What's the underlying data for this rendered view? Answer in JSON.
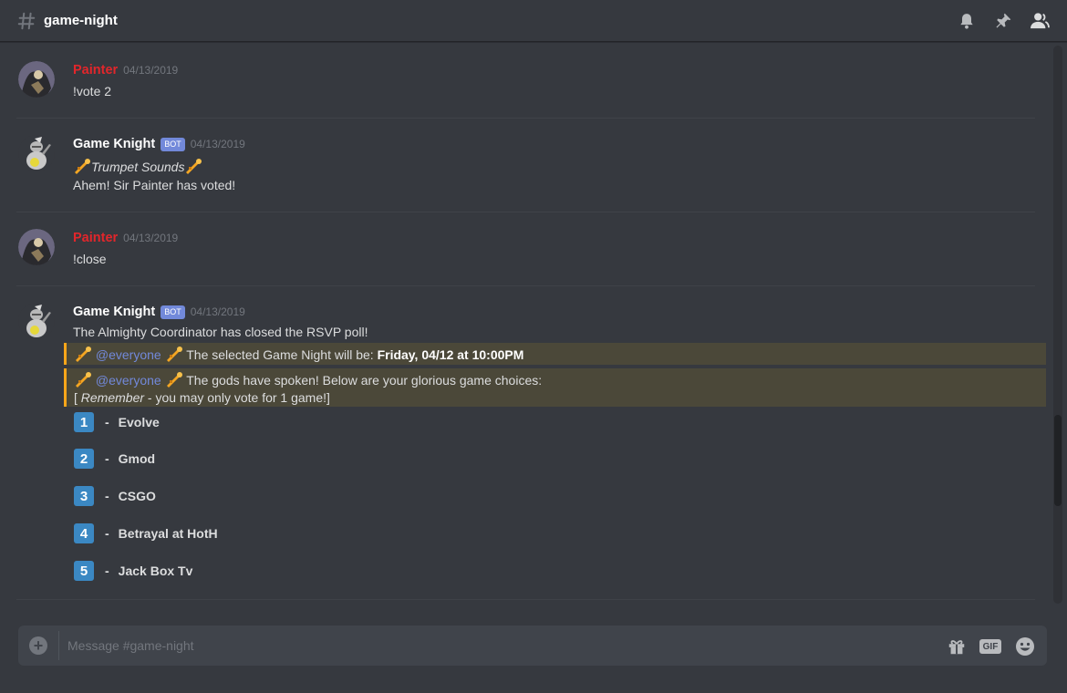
{
  "header": {
    "channel": "game-night"
  },
  "messages": [
    {
      "author": "Painter",
      "timestamp": "04/13/2019",
      "text": "!vote 2"
    },
    {
      "author": "Game Knight",
      "bot_tag": "BOT",
      "timestamp": "04/13/2019",
      "line1": "Trumpet Sounds",
      "line2": "Ahem! Sir Painter has voted!"
    },
    {
      "author": "Painter",
      "timestamp": "04/13/2019",
      "text": "!close"
    },
    {
      "author": "Game Knight",
      "bot_tag": "BOT",
      "timestamp": "04/13/2019",
      "text": "The Almighty Coordinator has closed the RSVP poll!",
      "highlight1": {
        "mention": "@everyone",
        "text": "The selected Game Night will be:",
        "bold": "Friday, 04/12 at 10:00PM"
      },
      "highlight2": {
        "mention": "@everyone",
        "text": "The gods have spoken! Below are your glorious game choices:",
        "note_open": "[",
        "note_italic": "Remember",
        "note_rest": "- you may only vote for 1 game!]"
      },
      "choices": [
        {
          "num": "1",
          "dash": "-",
          "name": "Evolve"
        },
        {
          "num": "2",
          "dash": "-",
          "name": "Gmod"
        },
        {
          "num": "3",
          "dash": "-",
          "name": "CSGO"
        },
        {
          "num": "4",
          "dash": "-",
          "name": "Betrayal at HotH"
        },
        {
          "num": "5",
          "dash": "-",
          "name": "Jack Box Tv"
        }
      ]
    }
  ],
  "composer": {
    "placeholder": "Message #game-night",
    "gif_label": "GIF",
    "plus": "+"
  },
  "colors": {
    "background": "#36393f",
    "painter": "#e2262b",
    "mention": "#7289da",
    "highlight_bar": "#faa61a",
    "number_box": "#3b88c3"
  },
  "icons": [
    "hash-icon",
    "bell-icon",
    "pin-icon",
    "members-icon",
    "trumpet-icon",
    "gift-icon",
    "emoji-icon"
  ]
}
